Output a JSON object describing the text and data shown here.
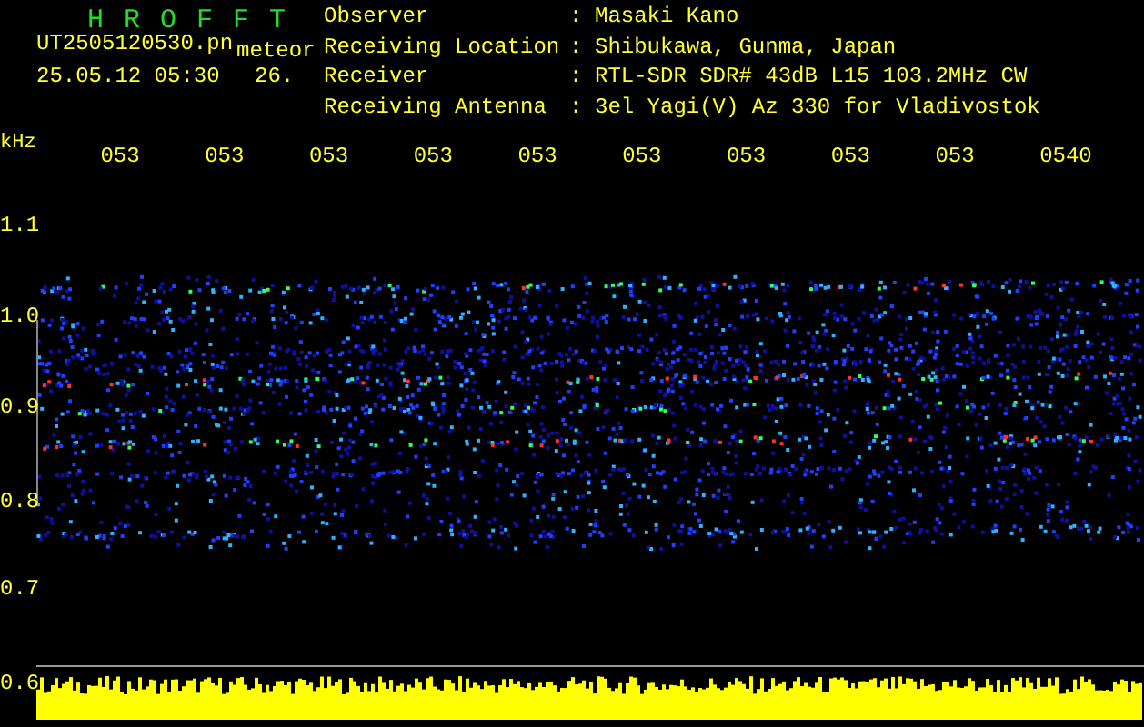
{
  "app": {
    "title": "H R O F F T"
  },
  "file": {
    "name": "UT2505120530.pn",
    "type": "meteor",
    "datetime": "25.05.12 05:30",
    "value": "26."
  },
  "info": [
    {
      "label": "Observer",
      "separator": ":",
      "value": "Masaki Kano"
    },
    {
      "label": "Receiving Location",
      "separator": ":",
      "value": "Shibukawa, Gunma, Japan"
    },
    {
      "label": "Receiver",
      "separator": ":",
      "value": "RTL-SDR SDR# 43dB L15 103.2MHz CW"
    },
    {
      "label": "Receiving Antenna",
      "separator": ":",
      "value": "3el Yagi(V) Az 330 for Vladivostok"
    }
  ],
  "axis": {
    "unit": "kHz",
    "time_labels": [
      "053",
      "053",
      "053",
      "053",
      "053",
      "053",
      "053",
      "053",
      "053",
      "0540"
    ],
    "freq_labels": [
      "1.1",
      "1.0",
      "0.9",
      "0.8",
      "0.7",
      "0.6"
    ]
  }
}
